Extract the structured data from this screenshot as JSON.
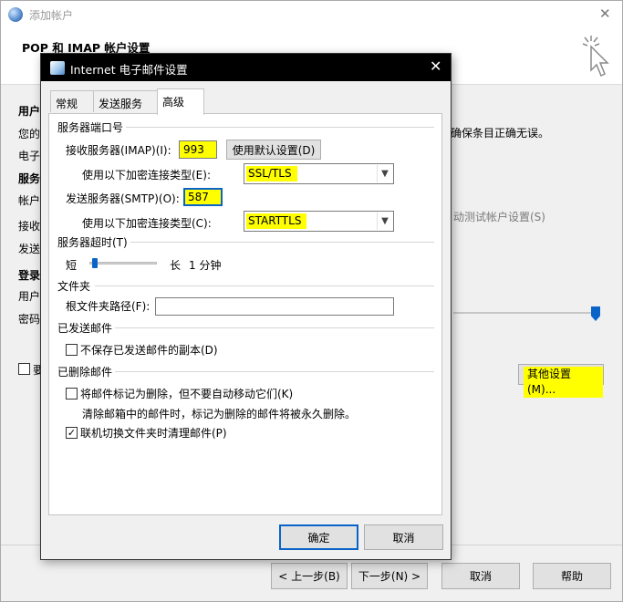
{
  "wizard": {
    "title": "添加帐户",
    "heading": "POP 和 IMAP 帐户设置",
    "sections": {
      "user": "用户",
      "server": "服务",
      "login": "登录"
    },
    "rows": {
      "r1": "您的",
      "r2": "电子",
      "r3": "帐户",
      "r4": "接收",
      "r5": "发送",
      "r6": "用户",
      "r7": "密码",
      "r8": "要"
    },
    "right_note": "确保条目正确无误。",
    "right_note2": "动测试帐户设置(S)",
    "more_settings": "其他设置(M)...",
    "buttons": {
      "back": "< 上一步(B)",
      "next": "下一步(N) >",
      "cancel": "取消",
      "help": "帮助"
    }
  },
  "dialog": {
    "title": "Internet 电子邮件设置",
    "tabs": [
      "常规",
      "发送服务器",
      "高级"
    ],
    "active_tab": "高级",
    "server_ports": {
      "group": "服务器端口号",
      "incoming_label": "接收服务器(IMAP)(I):",
      "incoming_value": "993",
      "use_defaults": "使用默认设置(D)",
      "incoming_enc_label": "使用以下加密连接类型(E):",
      "incoming_enc_value": "SSL/TLS",
      "outgoing_label": "发送服务器(SMTP)(O):",
      "outgoing_value": "587",
      "outgoing_enc_label": "使用以下加密连接类型(C):",
      "outgoing_enc_value": "STARTTLS"
    },
    "timeout": {
      "group": "服务器超时(T)",
      "short": "短",
      "long": "长",
      "value": "1 分钟",
      "level": 0.05
    },
    "folders": {
      "group": "文件夹",
      "root_label": "根文件夹路径(F):",
      "root_value": ""
    },
    "sent": {
      "group": "已发送邮件",
      "no_copy": "不保存已发送邮件的副本(D)",
      "no_copy_checked": false
    },
    "deleted": {
      "group": "已删除邮件",
      "mark_label": "将邮件标记为删除，但不要自动移动它们(K)",
      "mark_checked": false,
      "mark_note": "清除邮箱中的邮件时，标记为删除的邮件将被永久删除。",
      "purge_label": "联机切换文件夹时清理邮件(P)",
      "purge_checked": true
    },
    "ok": "确定",
    "cancel": "取消"
  },
  "colors": {
    "highlight": "#ffff00",
    "accent": "#0a64c8",
    "title_bar": "#000000"
  }
}
